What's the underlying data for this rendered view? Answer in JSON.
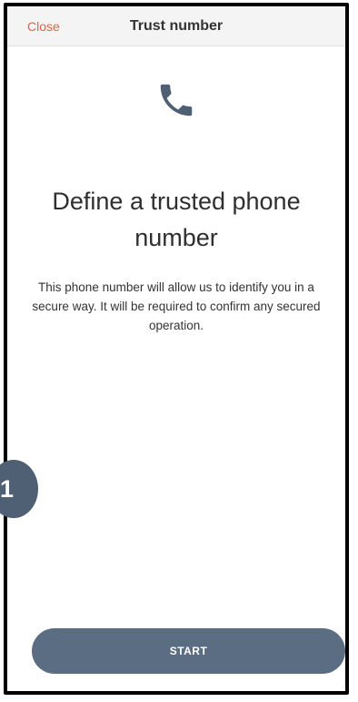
{
  "header": {
    "close_label": "Close",
    "title": "Trust number"
  },
  "icon": "phone-icon",
  "main": {
    "heading": "Define a trusted phone number",
    "description": "This phone number will allow us to identify you in a secure way. It will be required to confirm any secured operation."
  },
  "action": {
    "start_label": "START"
  },
  "annotation": {
    "step": "1"
  },
  "colors": {
    "close": "#d9654f",
    "icon": "#4f6075",
    "button": "#5b6d83",
    "badge": "#4f6075"
  }
}
